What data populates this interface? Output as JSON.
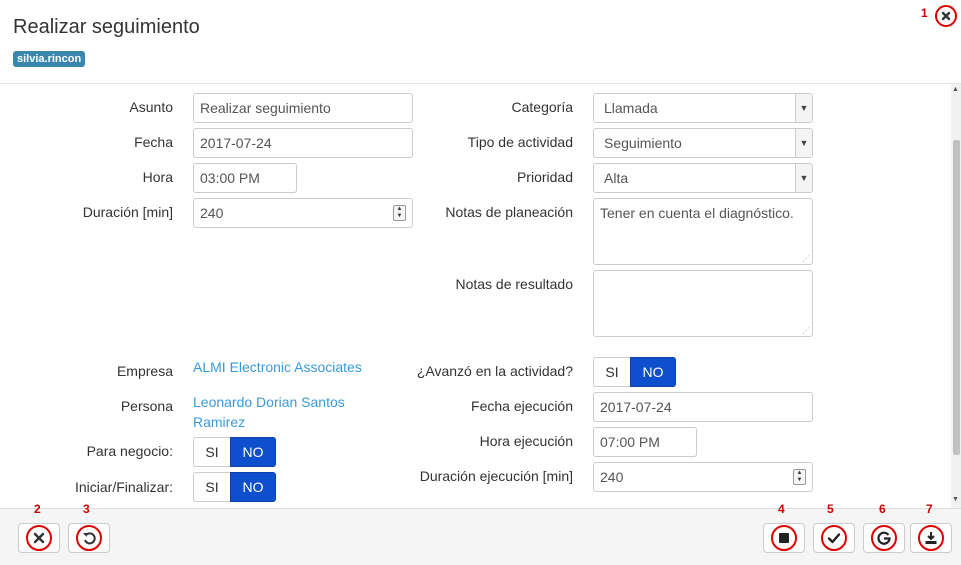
{
  "header": {
    "title": "Realizar seguimiento",
    "user_badge": "silvia.rincon"
  },
  "form_left": {
    "asunto": {
      "label": "Asunto",
      "value": "Realizar seguimiento"
    },
    "fecha": {
      "label": "Fecha",
      "value": "2017-07-24"
    },
    "hora": {
      "label": "Hora",
      "value": "03:00 PM"
    },
    "duracion": {
      "label": "Duración [min]",
      "value": "240"
    },
    "empresa": {
      "label": "Empresa",
      "value": "ALMI Electronic Associates"
    },
    "persona": {
      "label": "Persona",
      "value_line1": "Leonardo Dorian Santos",
      "value_line2": "Ramirez"
    },
    "para_negocio": {
      "label": "Para negocio:",
      "options": [
        "SI",
        "NO"
      ],
      "selected": "NO"
    },
    "iniciar_finalizar": {
      "label": "Iniciar/Finalizar:",
      "options": [
        "SI",
        "NO"
      ],
      "selected": "NO"
    }
  },
  "form_right": {
    "categoria": {
      "label": "Categoría",
      "value": "Llamada"
    },
    "tipo_actividad": {
      "label": "Tipo de actividad",
      "value": "Seguimiento"
    },
    "prioridad": {
      "label": "Prioridad",
      "value": "Alta"
    },
    "notas_planeacion": {
      "label": "Notas de planeación",
      "value": "Tener en cuenta el diagnóstico."
    },
    "notas_resultado": {
      "label": "Notas de resultado",
      "value": ""
    },
    "avanzo": {
      "label": "¿Avanzó en la actividad?",
      "options": [
        "SI",
        "NO"
      ],
      "selected": "NO"
    },
    "fecha_ejecucion": {
      "label": "Fecha ejecución",
      "value": "2017-07-24"
    },
    "hora_ejecucion": {
      "label": "Hora ejecución",
      "value": "07:00 PM"
    },
    "duracion_ejecucion": {
      "label": "Duración ejecución [min]",
      "value": "240"
    }
  },
  "annotations": [
    "1",
    "2",
    "3",
    "4",
    "5",
    "6",
    "7"
  ],
  "colors": {
    "accent_blue": "#0d4fcc",
    "badge": "#3a87ad",
    "link": "#3a9ad9",
    "annotation_red": "#dd0000"
  },
  "icons": {
    "corner_close": "close-icon",
    "footer_close": "close-icon",
    "undo": "undo-icon",
    "stop": "stop-icon",
    "check": "check-icon",
    "google": "google-icon",
    "download": "download-icon"
  }
}
